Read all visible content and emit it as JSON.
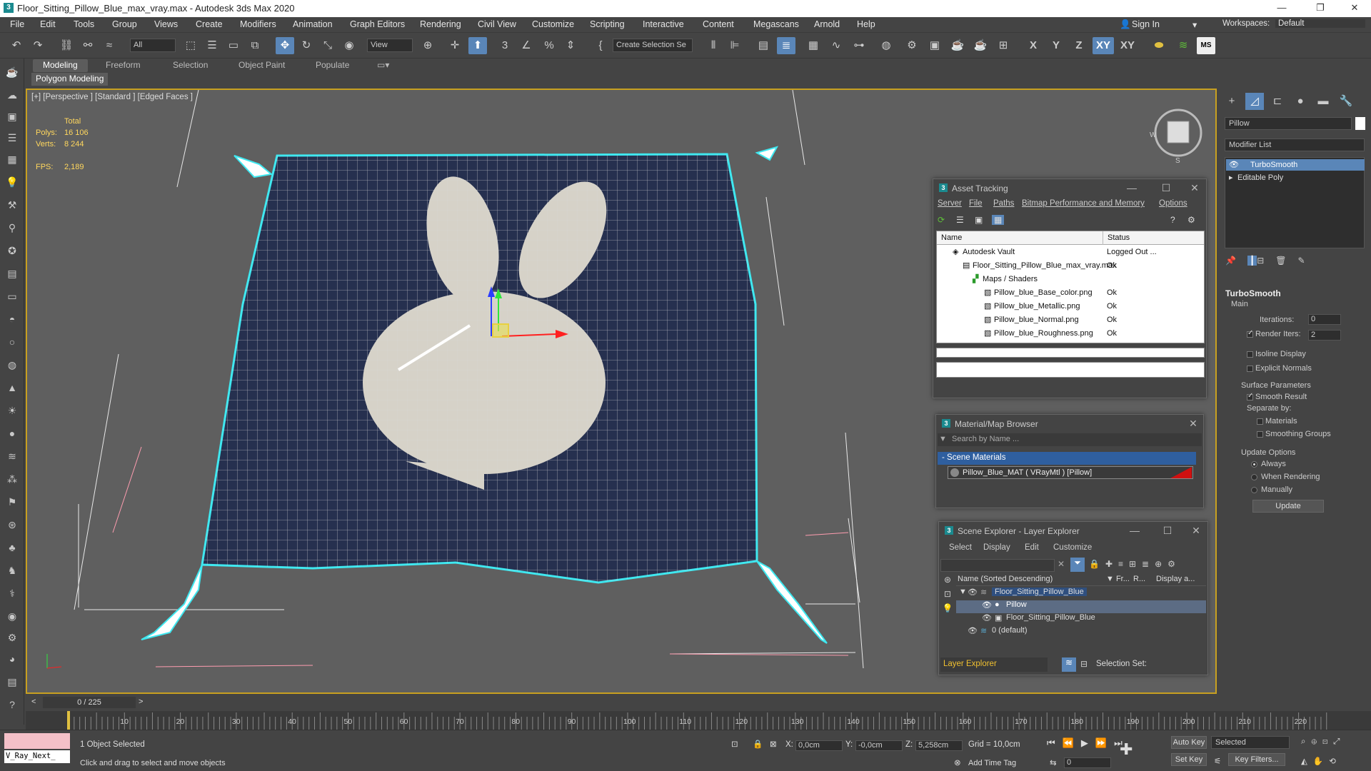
{
  "window": {
    "title": "Floor_Sitting_Pillow_Blue_max_vray.max - Autodesk 3ds Max 2020",
    "min": "—",
    "max": "❐",
    "close": "✕"
  },
  "menu": [
    "File",
    "Edit",
    "Tools",
    "Group",
    "Views",
    "Create",
    "Modifiers",
    "Animation",
    "Graph Editors",
    "Rendering",
    "Civil View",
    "Customize",
    "Scripting",
    "Interactive",
    "Content",
    "Megascans",
    "Arnold",
    "Help"
  ],
  "signin": {
    "label": "Sign In"
  },
  "workspaces": {
    "label": "Workspaces:",
    "value": "Default"
  },
  "toolbar": {
    "filter": "All",
    "view": "View",
    "selection_set": "Create Selection Se",
    "axes": [
      "X",
      "Y",
      "Z",
      "XY",
      "XY"
    ]
  },
  "ribbon": {
    "tabs": [
      "Modeling",
      "Freeform",
      "Selection",
      "Object Paint",
      "Populate"
    ],
    "active": "Modeling",
    "sub": "Polygon Modeling"
  },
  "viewport": {
    "label": "[+] [Perspective ] [Standard ] [Edged Faces ]",
    "stats": {
      "total_label": "Total",
      "polys_label": "Polys:",
      "polys": "16 106",
      "verts_label": "Verts:",
      "verts": "8 244",
      "fps_label": "FPS:",
      "fps": "2,189"
    }
  },
  "command_panel": {
    "object_name": "Pillow",
    "modifier_list": "Modifier List",
    "stack": [
      "TurboSmooth",
      "Editable Poly"
    ],
    "turbosmooth": {
      "title": "TurboSmooth",
      "main": "Main",
      "iterations_label": "Iterations:",
      "iterations": "0",
      "render_iters_label": "Render Iters:",
      "render_iters": "2",
      "isoline": "Isoline Display",
      "explicit_normals": "Explicit Normals",
      "surface_params": "Surface Parameters",
      "smooth_result": "Smooth Result",
      "separate_by": "Separate by:",
      "materials": "Materials",
      "smoothing_groups": "Smoothing Groups",
      "update_options": "Update Options",
      "always": "Always",
      "when_rendering": "When Rendering",
      "manually": "Manually",
      "update_button": "Update"
    }
  },
  "asset_tracking": {
    "title": "Asset Tracking",
    "menu": [
      "Server",
      "File",
      "Paths",
      "Bitmap Performance and Memory",
      "Options"
    ],
    "columns": [
      "Name",
      "Status"
    ],
    "rows": [
      {
        "name": "Autodesk Vault",
        "status": "Logged Out ..."
      },
      {
        "name": "Floor_Sitting_Pillow_Blue_max_vray.max",
        "status": "Ok"
      },
      {
        "name": "Maps / Shaders",
        "status": ""
      },
      {
        "name": "Pillow_blue_Base_color.png",
        "status": "Ok"
      },
      {
        "name": "Pillow_blue_Metallic.png",
        "status": "Ok"
      },
      {
        "name": "Pillow_blue_Normal.png",
        "status": "Ok"
      },
      {
        "name": "Pillow_blue_Roughness.png",
        "status": "Ok"
      }
    ]
  },
  "material_browser": {
    "title": "Material/Map Browser",
    "search_placeholder": "Search by Name ...",
    "section": "- Scene Materials",
    "item": "Pillow_Blue_MAT ( VRayMtl ) [Pillow]"
  },
  "scene_explorer": {
    "title": "Scene Explorer - Layer Explorer",
    "menu": [
      "Select",
      "Display",
      "Edit",
      "Customize"
    ],
    "columns": [
      "Name (Sorted Descending)",
      "▼ Fr...",
      "R...",
      "Display a..."
    ],
    "rows": [
      "Floor_Sitting_Pillow_Blue",
      "Pillow",
      "Floor_Sitting_Pillow_Blue",
      "0 (default)"
    ],
    "footer_layer": "Layer Explorer",
    "selection_set": "Selection Set:"
  },
  "timeline": {
    "frame": "0 / 225",
    "prev": "<",
    "next": ">",
    "ticks": [
      "10",
      "20",
      "30",
      "40",
      "50",
      "60",
      "70",
      "80",
      "90",
      "100",
      "110",
      "120",
      "130",
      "140",
      "150",
      "160",
      "170",
      "180",
      "190",
      "200",
      "210",
      "220"
    ]
  },
  "status": {
    "script": "V_Ray_Next_",
    "selected": "1 Object Selected",
    "hint": "Click and drag to select and move objects",
    "x_label": "X:",
    "x": "0,0cm",
    "y_label": "Y:",
    "y": "-0,0cm",
    "z_label": "Z:",
    "z": "5,258cm",
    "grid": "Grid = 10,0cm",
    "add_time_tag": "Add Time Tag",
    "auto_key": "Auto Key",
    "set_key": "Set Key",
    "selected_dd": "Selected",
    "key_filters": "Key Filters...",
    "frame_field": "0"
  },
  "colors": {
    "accent": "#5a86b8",
    "viewport_border": "#c8a020",
    "wire": "#3fe8f0",
    "pillow": "#26304f"
  }
}
